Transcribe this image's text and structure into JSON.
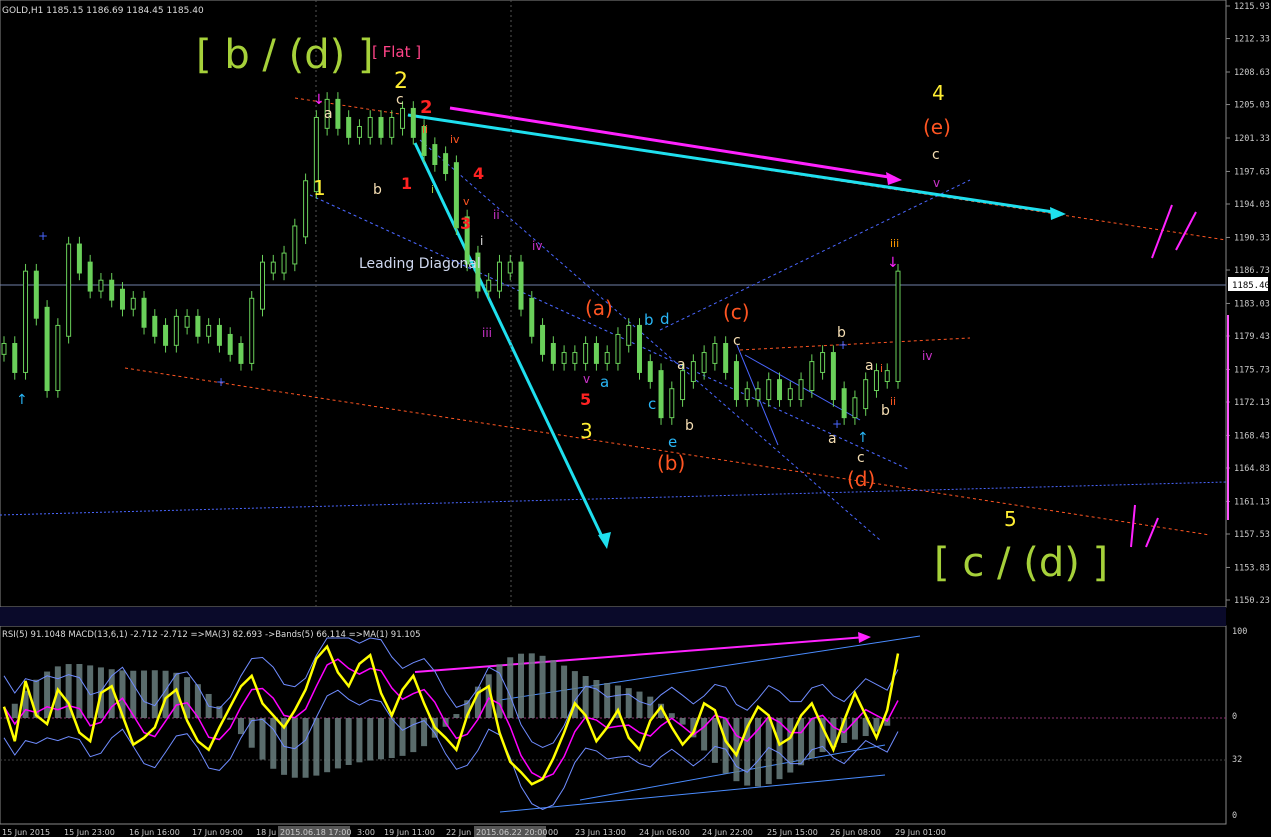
{
  "chart_data": {
    "type": "line",
    "symbol_header": "GOLD,H1  1185.15 1186.69 1184.45 1185.40",
    "current_price": "1185.40",
    "price_axis_labels": [
      "1215.93",
      "1212.33",
      "1208.63",
      "1205.03",
      "1201.33",
      "1197.63",
      "1194.03",
      "1190.33",
      "1186.73",
      "1183.03",
      "1179.43",
      "1175.73",
      "1172.13",
      "1168.43",
      "1164.83",
      "1161.13",
      "1157.53",
      "1153.83",
      "1150.23"
    ],
    "price_ylim": [
      1150.23,
      1215.93
    ],
    "time_axis_labels": [
      "15 Jun 2015",
      "15 Jun 23:00",
      "16 Jun 16:00",
      "17 Jun 09:00",
      "18 Ju",
      "2015.06.18 17:00",
      "3:00",
      "19 Jun 11:00",
      "22 Jun",
      "2015.06.22 20:00",
      "00",
      "23 Jun 13:00",
      "24 Jun 06:00",
      "24 Jun 22:00",
      "25 Jun 15:00",
      "26 Jun 08:00",
      "29 Jun 01:00"
    ],
    "price_series": [
      1178,
      1176,
      1186,
      1182,
      1174,
      1180,
      1189,
      1187,
      1185,
      1185,
      1184,
      1183,
      1183,
      1181,
      1180,
      1179,
      1181,
      1181,
      1180,
      1180,
      1179,
      1178,
      1177,
      1183,
      1187,
      1187,
      1188,
      1191,
      1196,
      1203,
      1205,
      1203,
      1202,
      1202,
      1203,
      1202,
      1203,
      1204,
      1202,
      1200,
      1199,
      1198,
      1192,
      1188,
      1185,
      1185,
      1187,
      1187,
      1183,
      1180,
      1178,
      1177,
      1177,
      1177,
      1178,
      1177,
      1177,
      1179,
      1180,
      1176,
      1175,
      1171,
      1173,
      1175,
      1176,
      1177,
      1178,
      1176,
      1173,
      1173,
      1173,
      1174,
      1173,
      1173,
      1174,
      1176,
      1177,
      1173,
      1171,
      1172,
      1174,
      1175,
      1175,
      1186
    ],
    "labels": {
      "wave_b_d": "[ b / (d) ]",
      "flat": "[ Flat ]",
      "wave_c_d": "[ c / (d) ]",
      "leading_diagonal": "Leading Diagonal",
      "n1": "1",
      "n2": "2",
      "n3": "3",
      "n4": "4",
      "n5": "5",
      "r1": "1",
      "r2": "2",
      "r3": "3",
      "r4": "4",
      "r5": "5",
      "pa": "(a)",
      "pb": "(b)",
      "pc": "(c)",
      "pd": "(d)",
      "pe": "(e)",
      "a": "a",
      "b": "b",
      "c": "c",
      "d": "d",
      "e": "e",
      "i": "i",
      "ii": "ii",
      "iii": "iii",
      "iv": "iv",
      "v": "v"
    },
    "indicator_header": "RSI(5) 91.1048  MACD(13,6,1) -2.712 -2.712  =>MA(3) 82.693  ->Bands(5) 66.114  =>MA(1) 91.105",
    "indicator_axis_labels": [
      "100",
      "0",
      "32",
      "0"
    ],
    "rsi_values": [
      60,
      40,
      75,
      55,
      50,
      70,
      62,
      45,
      40,
      68,
      72,
      55,
      38,
      42,
      48,
      65,
      70,
      52,
      40,
      35,
      48,
      60,
      72,
      78,
      62,
      55,
      48,
      58,
      70,
      88,
      95,
      80,
      72,
      85,
      90,
      68,
      55,
      70,
      78,
      62,
      48,
      42,
      35,
      55,
      68,
      72,
      45,
      28,
      22,
      15,
      18,
      30,
      45,
      62,
      55,
      40,
      48,
      58,
      42,
      35,
      52,
      60,
      48,
      38,
      45,
      62,
      58,
      40,
      32,
      48,
      60,
      55,
      38,
      42,
      55,
      62,
      48,
      35,
      52,
      68,
      55,
      42,
      58,
      91
    ],
    "colors": {
      "background": "#000000",
      "candle": "#6ad05a",
      "rsi": "#ffff00",
      "ma": "#ff00ff",
      "bands": "#6f8cff",
      "trend_cyan": "#1fe0ef",
      "trend_magenta": "#ff22ff",
      "orange": "#ff5522",
      "lime": "#a6d13a",
      "macd_hist": "#6a7f7f"
    }
  }
}
